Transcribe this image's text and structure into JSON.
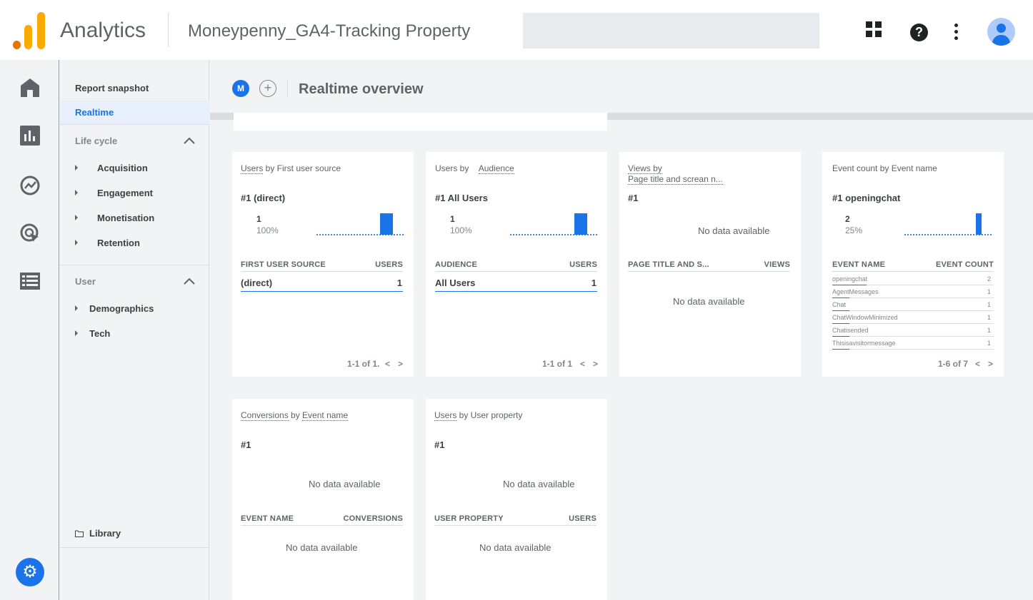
{
  "header": {
    "app_name": "Analytics",
    "property": "Moneypenny_GA4-Tracking Property",
    "search_placeholder": ""
  },
  "nav": {
    "report_snapshot": "Report snapshot",
    "realtime": "Realtime",
    "lifecycle_label": "Life cycle",
    "lifecycle_items": [
      "Acquisition",
      "Engagement",
      "Monetisation",
      "Retention"
    ],
    "user_label": "User",
    "user_items": [
      "Demographics",
      "Tech"
    ],
    "library": "Library"
  },
  "main": {
    "comparison_chip": "M",
    "add_comparison": "+",
    "title": "Realtime overview"
  },
  "cards": {
    "first_user_source": {
      "title_a": "Users",
      "title_b": " by First user source",
      "rank": "#1 (direct)",
      "value": "1",
      "percent": "100%",
      "col_left": "FIRST USER SOURCE",
      "col_right": "USERS",
      "row_label": "(direct)",
      "row_value": "1",
      "pager": "1-1 of 1.",
      "prev": "<",
      "next": ">"
    },
    "audience": {
      "title_a": "Users by",
      "title_b": "Audience",
      "rank": "#1 All Users",
      "value": "1",
      "percent": "100%",
      "col_left": "AUDIENCE",
      "col_right": "USERS",
      "row_label": "All Users",
      "row_value": "1",
      "pager": "1-1 of 1",
      "prev": "<",
      "next": ">"
    },
    "views": {
      "title_a": "Views by",
      "title_b": "Page title and screan n...",
      "rank": "#1",
      "no_data_top": "No data available",
      "col_left": "PAGE TITLE AND S...",
      "col_right": "VIEWS",
      "no_data_table": "No data available"
    },
    "event_count": {
      "title": "Event count by Event name",
      "rank": "#1 openingchat",
      "value": "2",
      "percent": "25%",
      "col_left": "EVENT NAME",
      "col_right": "EVENT COUNT",
      "rows": [
        {
          "name": "openingchat",
          "value": "2"
        },
        {
          "name": "AgentMessages",
          "value": "1"
        },
        {
          "name": "Chat",
          "value": "1"
        },
        {
          "name": "ChatWindowMinimized",
          "value": "1"
        },
        {
          "name": "Chatisended",
          "value": "1"
        },
        {
          "name": "Thisisavisitormessage",
          "value": "1"
        }
      ],
      "pager": "1-6 of 7",
      "prev": "<",
      "next": ">"
    },
    "conversions": {
      "title_a": "Conversions",
      "title_b": " by ",
      "title_c": "Event name",
      "rank": "#1",
      "no_data_top": "No data available",
      "col_left": "EVENT NAME",
      "col_right": "CONVERSIONS",
      "no_data_table": "No data available"
    },
    "user_property": {
      "title_a": "Users",
      "title_b": " by User property",
      "rank": "#1",
      "no_data_top": "No data available",
      "col_left": "USER PROPERTY",
      "col_right": "USERS",
      "no_data_table": "No data available"
    }
  },
  "colors": {
    "accent": "#1a73e8",
    "logo_orange": "#f9ab00",
    "logo_dark_orange": "#e37400"
  }
}
